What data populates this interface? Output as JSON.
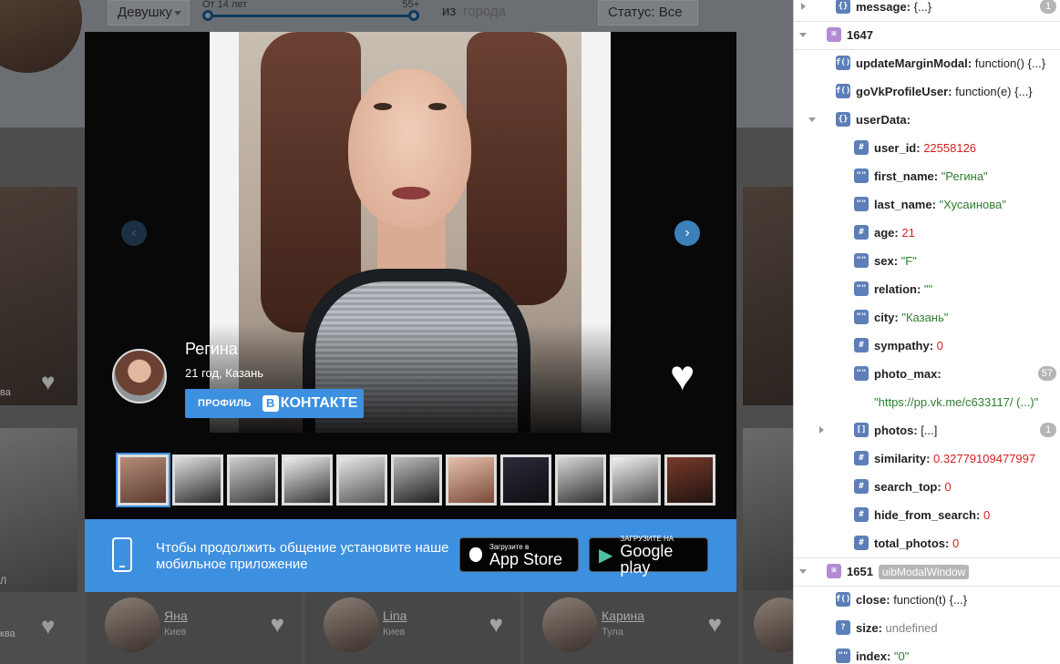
{
  "site": {
    "gender_select": "Девушку",
    "age_from": "От 14 лет",
    "age_to": "55+",
    "city_label": "из",
    "city_placeholder": "города",
    "status_select": "Статус: Все",
    "bottom_cards": [
      {
        "name": "Яна",
        "city": "Киев"
      },
      {
        "name": "Lina",
        "city": "Киев"
      },
      {
        "name": "Карина",
        "city": "Тула"
      }
    ],
    "side_text_1": "ва",
    "side_text_2": "ква",
    "side_text_3": "Л"
  },
  "modal": {
    "user": {
      "name": "Регина",
      "age_city": "21 год, Казань"
    },
    "vk_button": {
      "label": "ПРОФИЛЬ",
      "brand_mark": "В",
      "brand_text": "КОНТАКТЕ"
    },
    "nav": {
      "prev": "‹",
      "next": "›"
    },
    "like_icon": "♥",
    "thumbnails_count": 11,
    "banner": {
      "text": "Чтобы продолжить общение установите наше мобильное приложение",
      "appstore_small": "Загрузите в",
      "appstore_large": "App Store",
      "gplay_small": "ЗАГРУЗИТЕ НА",
      "gplay_large": "Google play"
    }
  },
  "devtools": {
    "rows": [
      {
        "type": "obj",
        "badge": "{}",
        "key": "message",
        "value": "{...}",
        "count": "1"
      },
      {
        "type": "scope",
        "badge": "⌘",
        "key": "1647",
        "value": ""
      },
      {
        "type": "fn",
        "badge": "f()",
        "key": "updateMarginModal",
        "value": "function() {...}"
      },
      {
        "type": "fn",
        "badge": "f()",
        "key": "goVkProfileUser",
        "value": "function(e) {...}"
      },
      {
        "type": "obj",
        "badge": "{}",
        "key": "userData",
        "value": ""
      },
      {
        "type": "num",
        "badge": "#",
        "key": "user_id",
        "value": "22558126"
      },
      {
        "type": "str",
        "badge": "\"\"",
        "key": "first_name",
        "value": "\"Регина\""
      },
      {
        "type": "str",
        "badge": "\"\"",
        "key": "last_name",
        "value": "\"Хусаинова\""
      },
      {
        "type": "num",
        "badge": "#",
        "key": "age",
        "value": "21"
      },
      {
        "type": "str",
        "badge": "\"\"",
        "key": "sex",
        "value": "\"F\""
      },
      {
        "type": "str",
        "badge": "\"\"",
        "key": "relation",
        "value": "\"\""
      },
      {
        "type": "str",
        "badge": "\"\"",
        "key": "city",
        "value": "\"Казань\""
      },
      {
        "type": "num",
        "badge": "#",
        "key": "sympathy",
        "value": "0"
      },
      {
        "type": "str",
        "badge": "\"\"",
        "key": "photo_max",
        "value": "",
        "count": "57"
      },
      {
        "type": "strcont",
        "badge": "",
        "key": "",
        "value": "\"https://pp.vk.me/c633117/ (...)\""
      },
      {
        "type": "arr",
        "badge": "[]",
        "key": "photos",
        "value": "[...]",
        "count": "1"
      },
      {
        "type": "num",
        "badge": "#",
        "key": "similarity",
        "value": "0.32779109477997"
      },
      {
        "type": "num",
        "badge": "#",
        "key": "search_top",
        "value": "0"
      },
      {
        "type": "num",
        "badge": "#",
        "key": "hide_from_search",
        "value": "0"
      },
      {
        "type": "num",
        "badge": "#",
        "key": "total_photos",
        "value": "0"
      },
      {
        "type": "scope",
        "badge": "⌘",
        "key": "1651",
        "value": "",
        "tag": "uibModalWindow"
      },
      {
        "type": "fn",
        "badge": "f()",
        "key": "close",
        "value": "function(t) {...}"
      },
      {
        "type": "undef",
        "badge": "?",
        "key": "size",
        "value": "undefined"
      },
      {
        "type": "str",
        "badge": "\"\"",
        "key": "index",
        "value": "\"0\""
      }
    ]
  },
  "colors": {
    "accent_blue": "#3d8fe0",
    "string_green": "#2f7d2f",
    "number_red": "#d52020"
  }
}
